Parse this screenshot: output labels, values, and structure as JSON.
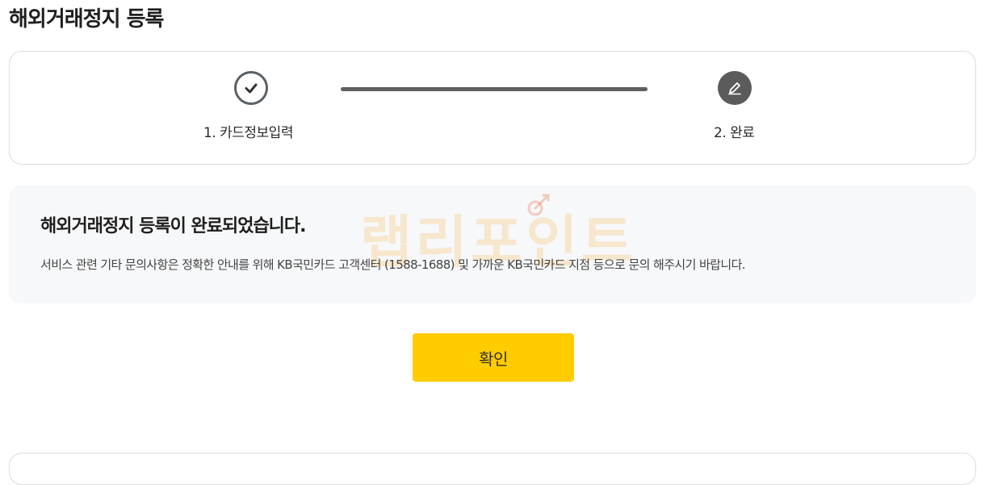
{
  "page": {
    "title": "해외거래정지 등록"
  },
  "stepper": {
    "steps": [
      {
        "label": "1. 카드정보입력",
        "icon": "check-icon",
        "status": "done"
      },
      {
        "label": "2. 완료",
        "icon": "pencil-icon",
        "status": "current"
      }
    ]
  },
  "message": {
    "heading": "해외거래정지 등록이 완료되었습니다.",
    "body": "서비스 관련 기타 문의사항은 정확한 안내를 위해 KB국민카드 고객센터 (1588-1688) 및 가까운 KB국민카드 지점 등으로 문의 해주시기 바랍니다."
  },
  "watermark": {
    "text": "랩리포인트"
  },
  "actions": {
    "confirm_label": "확인"
  },
  "colors": {
    "accent": "#ffcc00",
    "step_done": "#5b6166",
    "step_current": "#5b5b5b",
    "message_bg": "#f7f8fa"
  }
}
